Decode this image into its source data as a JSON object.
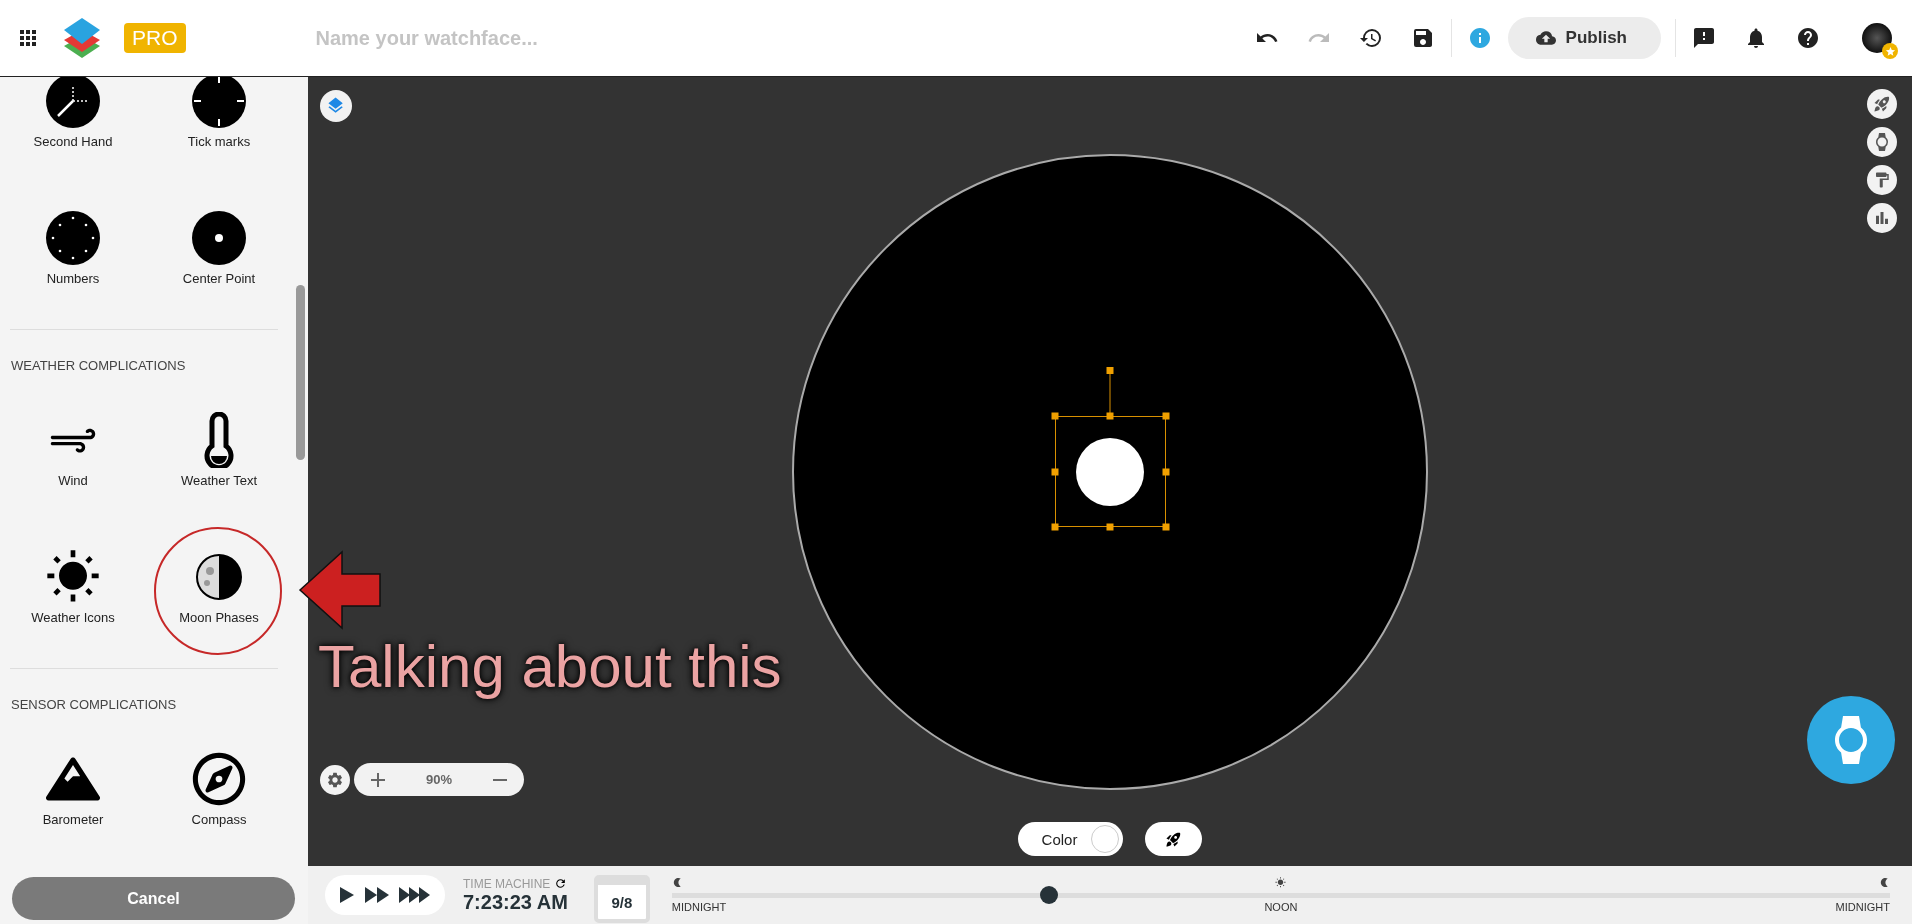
{
  "header": {
    "badge": "PRO",
    "name_placeholder": "Name your watchface...",
    "publish": "Publish"
  },
  "sidebar": {
    "sections": [
      {
        "items": [
          {
            "label": "Second Hand",
            "kind": "second_hand"
          },
          {
            "label": "Tick marks",
            "kind": "tick_marks"
          },
          {
            "label": "Numbers",
            "kind": "numbers"
          },
          {
            "label": "Center Point",
            "kind": "center_point"
          }
        ]
      },
      {
        "title": "WEATHER COMPLICATIONS",
        "items": [
          {
            "label": "Wind",
            "kind": "wind"
          },
          {
            "label": "Weather Text",
            "kind": "thermometer"
          },
          {
            "label": "Weather Icons",
            "kind": "sun"
          },
          {
            "label": "Moon Phases",
            "kind": "moon_phase"
          }
        ]
      },
      {
        "title": "SENSOR COMPLICATIONS",
        "items": [
          {
            "label": "Barometer",
            "kind": "mountain"
          },
          {
            "label": "Compass",
            "kind": "compass"
          }
        ]
      }
    ],
    "cancel": "Cancel"
  },
  "canvas": {
    "zoom": "90%",
    "color_label": "Color"
  },
  "annotation": {
    "text": "Talking about this"
  },
  "time_machine": {
    "title": "TIME MACHINE",
    "time": "7:23:23 AM",
    "date": "9/8",
    "level": 0.31,
    "labels": [
      "MIDNIGHT",
      "NOON",
      "MIDNIGHT"
    ]
  }
}
